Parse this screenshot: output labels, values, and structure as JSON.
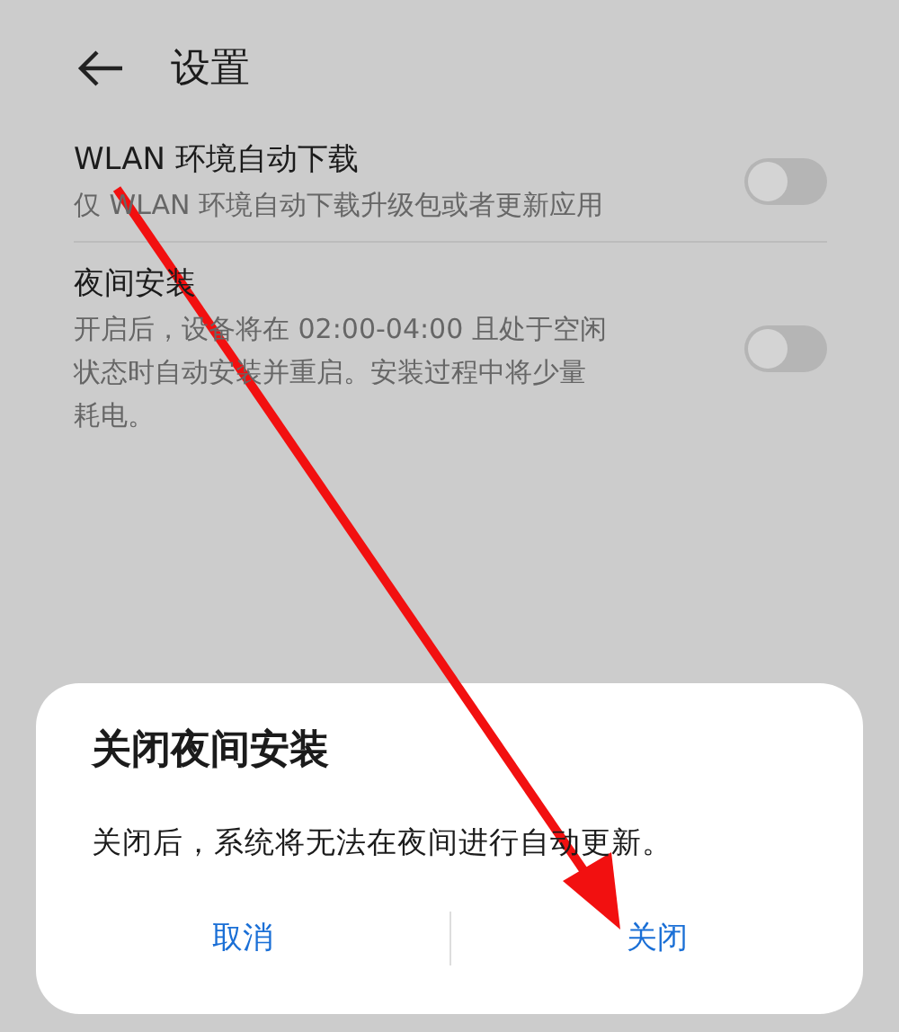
{
  "header": {
    "title": "设置"
  },
  "settings": [
    {
      "title": "WLAN 环境自动下载",
      "description": "仅 WLAN 环境自动下载升级包或者更新应用",
      "on": false
    },
    {
      "title": "夜间安装",
      "description": "开启后，设备将在 02:00-04:00 且处于空闲状态时自动安装并重启。安装过程中将少量耗电。",
      "on": false
    }
  ],
  "dialog": {
    "title": "关闭夜间安装",
    "message": "关闭后，系统将无法在夜间进行自动更新。",
    "buttons": [
      "取消",
      "关闭"
    ]
  }
}
